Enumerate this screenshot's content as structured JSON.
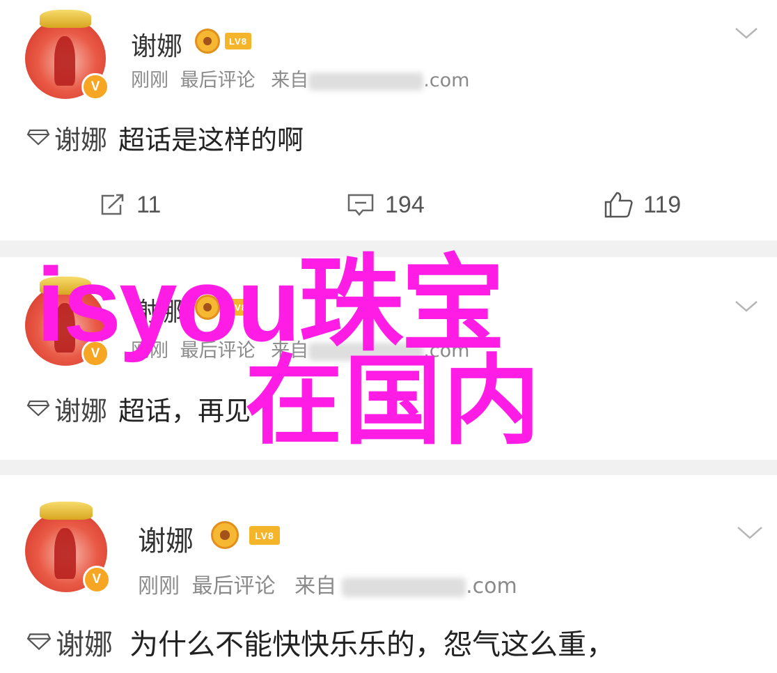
{
  "overlay": {
    "line1": "isyou珠宝",
    "line2": "在国内",
    "color": "#ff1de5"
  },
  "colors": {
    "separator": "#f1f1f1",
    "meta_gray": "#8a8a8a",
    "badge_gold": "#f5b52a",
    "avatar_red": "#e95a46"
  },
  "posts": [
    {
      "username": "谢娜",
      "lv_badge": "LV8",
      "verified_mark": "V",
      "meta_time": "刚刚",
      "meta_action": "最后评论",
      "meta_from": "来自",
      "meta_source_suffix": ".com",
      "topic": "谢娜",
      "text": "超话是这样的啊",
      "reposts": "11",
      "comments": "194",
      "likes": "119"
    },
    {
      "username": "谢娜",
      "lv_badge": "LV8",
      "verified_mark": "V",
      "meta_time": "刚刚",
      "meta_action": "最后评论",
      "meta_from": "来自",
      "meta_source_suffix": ".com",
      "topic": "谢娜",
      "text": "超话，再见"
    },
    {
      "username": "谢娜",
      "lv_badge": "LV8",
      "verified_mark": "V",
      "meta_time": "刚刚",
      "meta_action": "最后评论",
      "meta_from": "来自",
      "meta_source_suffix": ".com",
      "topic": "谢娜",
      "text": "为什么不能快快乐乐的，怨气这么重，"
    }
  ],
  "icons": [
    "avatar",
    "crown-medal-icon",
    "lv-badge",
    "verified-badge-icon",
    "chevron-down-icon",
    "super-topic-diamond-icon",
    "repost-icon",
    "comment-icon",
    "like-icon"
  ]
}
